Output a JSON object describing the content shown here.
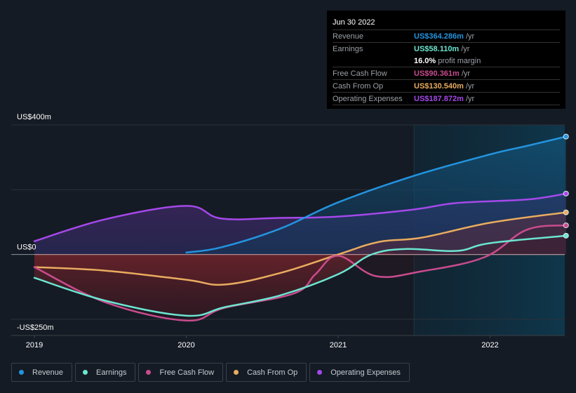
{
  "tooltip": {
    "date": "Jun 30 2022",
    "rows": [
      {
        "label": "Revenue",
        "value": "US$364.286m",
        "unit": "/yr",
        "color": "#2394df"
      },
      {
        "label": "Earnings",
        "value": "US$58.110m",
        "unit": "/yr",
        "color": "#6ce5d1"
      },
      {
        "label": "",
        "value": "16.0%",
        "unit": "profit margin",
        "color": "#ffffff"
      },
      {
        "label": "Free Cash Flow",
        "value": "US$90.361m",
        "unit": "/yr",
        "color": "#c94c8e"
      },
      {
        "label": "Cash From Op",
        "value": "US$130.540m",
        "unit": "/yr",
        "color": "#e9ac5f"
      },
      {
        "label": "Operating Expenses",
        "value": "US$187.872m",
        "unit": "/yr",
        "color": "#a548ea"
      }
    ]
  },
  "chart_data": {
    "type": "area",
    "title": "",
    "xlabel": "",
    "ylabel": "",
    "ylim": [
      -250,
      400
    ],
    "xlim": [
      2018.95,
      2022.5
    ],
    "y_ticks": [
      {
        "value": 400,
        "label": "US$400m"
      },
      {
        "value": 0,
        "label": "US$0"
      },
      {
        "value": -250,
        "label": "-US$250m"
      }
    ],
    "x_ticks": [
      {
        "value": 2019,
        "label": "2019"
      },
      {
        "value": 2020,
        "label": "2020"
      },
      {
        "value": 2021,
        "label": "2021"
      },
      {
        "value": 2022,
        "label": "2022"
      }
    ],
    "highlight_start": 2021.5,
    "grid": true,
    "legend_position": "bottom",
    "series": [
      {
        "name": "Operating Expenses",
        "color": "#a548ea",
        "x": [
          2019.0,
          2019.47,
          2020.0,
          2020.23,
          2020.62,
          2021.0,
          2021.5,
          2021.78,
          2022.25,
          2022.5
        ],
        "values": [
          41,
          109,
          150,
          111,
          113,
          117,
          139,
          159,
          170,
          188
        ]
      },
      {
        "name": "Revenue",
        "color": "#2394df",
        "x": [
          2020.0,
          2020.23,
          2020.62,
          2021.0,
          2021.5,
          2022.0,
          2022.24,
          2022.5
        ],
        "values": [
          6,
          22,
          80,
          161,
          243,
          309,
          335,
          364
        ]
      },
      {
        "name": "Cash From Op",
        "color": "#e9ac5f",
        "x": [
          2019.0,
          2019.47,
          2020.0,
          2020.25,
          2020.62,
          2021.0,
          2021.27,
          2021.55,
          2022.0,
          2022.5
        ],
        "values": [
          -39,
          -50,
          -78,
          -93,
          -57,
          0,
          39,
          52,
          98,
          130
        ]
      },
      {
        "name": "Free Cash Flow",
        "color": "#c94c8e",
        "x": [
          2019.0,
          2019.47,
          2020.0,
          2020.25,
          2020.71,
          2020.85,
          2021.0,
          2021.25,
          2021.55,
          2021.96,
          2022.24,
          2022.5
        ],
        "values": [
          -39,
          -148,
          -204,
          -165,
          -120,
          -61,
          -4,
          -67,
          -52,
          -9,
          76,
          90
        ]
      },
      {
        "name": "Earnings",
        "color": "#6ce5d1",
        "x": [
          2019.0,
          2019.47,
          2020.0,
          2020.25,
          2020.62,
          2021.0,
          2021.22,
          2021.45,
          2021.78,
          2022.0,
          2022.5
        ],
        "values": [
          -72,
          -143,
          -189,
          -163,
          -126,
          -61,
          0,
          17,
          11,
          35,
          58
        ]
      }
    ]
  },
  "legend": [
    {
      "label": "Revenue",
      "color": "#2394df"
    },
    {
      "label": "Earnings",
      "color": "#6ce5d1"
    },
    {
      "label": "Free Cash Flow",
      "color": "#c94c8e"
    },
    {
      "label": "Cash From Op",
      "color": "#e9ac5f"
    },
    {
      "label": "Operating Expenses",
      "color": "#a548ea"
    }
  ]
}
